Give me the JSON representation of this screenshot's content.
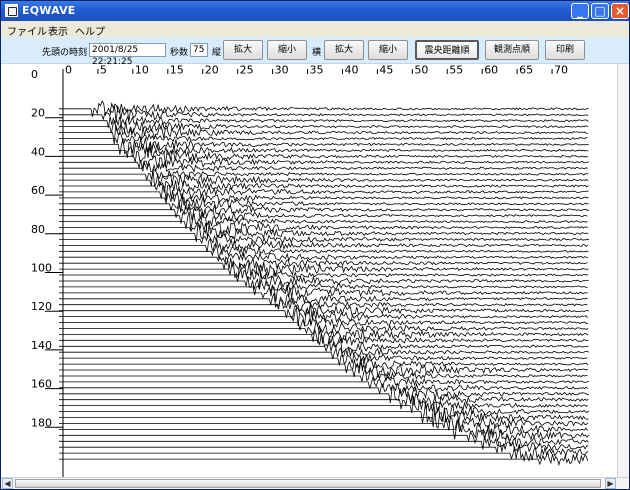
{
  "window": {
    "title": "EQWAVE",
    "controls": {
      "minimize": "_",
      "maximize": "□",
      "close": "×"
    }
  },
  "menubar": {
    "items": [
      "ファイル",
      "表示",
      "ヘルプ"
    ]
  },
  "toolbar": {
    "start_time_label": "先頭の時刻",
    "start_time_value": "2001/8/25 22:21:25",
    "seconds_label": "秒数",
    "seconds_value": "75",
    "vertical_label": "縦",
    "vertical_zoom_in": "拡大",
    "vertical_zoom_out": "縮小",
    "horizontal_label": "横",
    "horizontal_zoom_in": "拡大",
    "horizontal_zoom_out": "縮小",
    "sort_epicentral": "震央距離順",
    "sort_station": "観測点順",
    "print": "印刷"
  },
  "chart_data": {
    "type": "line",
    "x_ticks": [
      "0",
      "5",
      "10",
      "15",
      "20",
      "25",
      "30",
      "35",
      "40",
      "45",
      "50",
      "55",
      "60",
      "65",
      "70"
    ],
    "y_ticks": [
      "0",
      "20",
      "40",
      "60",
      "80",
      "100",
      "120",
      "140",
      "160",
      "180"
    ],
    "xlim": [
      0,
      75
    ],
    "ylim": [
      0,
      200
    ],
    "grid": false,
    "legend": "none",
    "trace_count": 60,
    "onset": {
      "x": [
        4,
        6,
        8,
        10,
        12,
        15,
        18,
        21,
        24,
        28,
        32,
        36,
        40,
        44,
        48,
        52,
        56,
        60,
        64,
        68
      ],
      "y": [
        18,
        22,
        37,
        42,
        53,
        66,
        79,
        91,
        102,
        112,
        123,
        136,
        149,
        160,
        168,
        176,
        184,
        190,
        196,
        199
      ]
    },
    "colors": {
      "trace": "#000000",
      "axis": "#000000",
      "background": "#ffffff"
    }
  },
  "scrollbars": {
    "left_arrow": "◀",
    "right_arrow": "▶"
  }
}
